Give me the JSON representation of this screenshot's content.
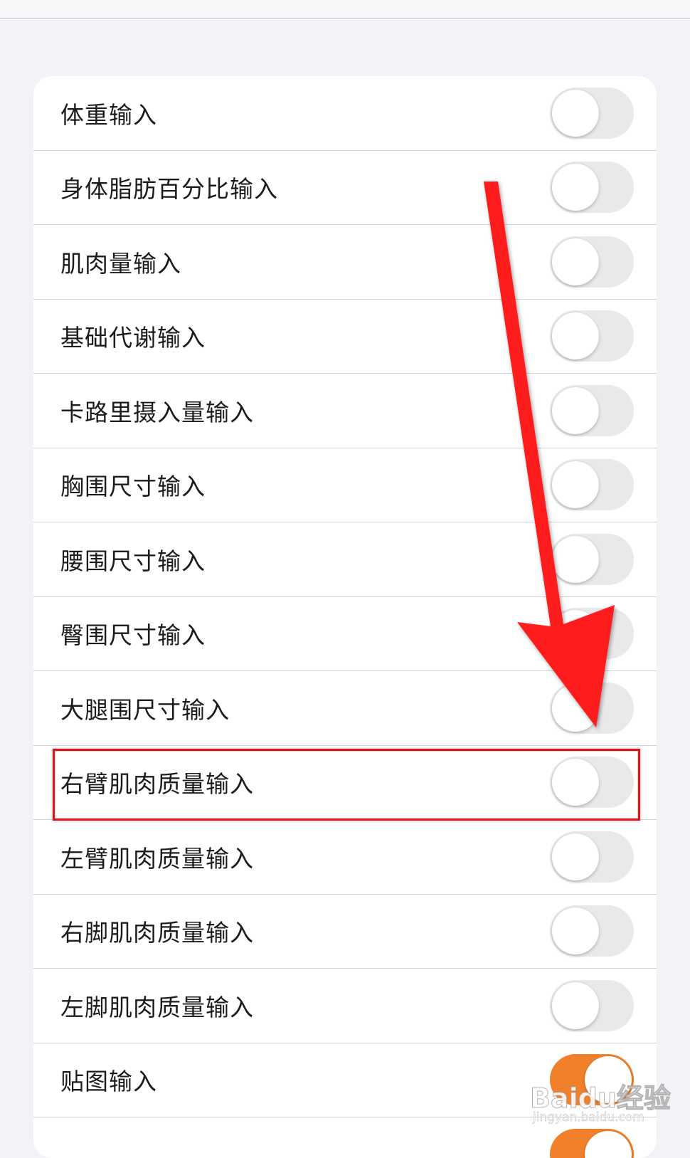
{
  "settings": {
    "items": [
      {
        "label": "体重输入",
        "on": false
      },
      {
        "label": "身体脂肪百分比输入",
        "on": false
      },
      {
        "label": "肌肉量输入",
        "on": false
      },
      {
        "label": "基础代谢输入",
        "on": false
      },
      {
        "label": "卡路里摄入量输入",
        "on": false
      },
      {
        "label": "胸围尺寸输入",
        "on": false
      },
      {
        "label": "腰围尺寸输入",
        "on": false
      },
      {
        "label": "臀围尺寸输入",
        "on": false
      },
      {
        "label": "大腿围尺寸输入",
        "on": false
      },
      {
        "label": "右臂肌肉质量输入",
        "on": false
      },
      {
        "label": "左臂肌肉质量输入",
        "on": false
      },
      {
        "label": "右脚肌肉质量输入",
        "on": false
      },
      {
        "label": "左脚肌肉质量输入",
        "on": false
      },
      {
        "label": "贴图输入",
        "on": true
      },
      {
        "label": "",
        "on": true
      }
    ]
  },
  "annotation": {
    "highlighted_item": "右臂肌肉质量输入",
    "highlight_color": "#e0141b",
    "arrow_color": "#ff1a1a",
    "toggle_on_color": "#f0802b",
    "toggle_off_color": "#e9e9eb"
  },
  "watermark": {
    "main": "Baidu经验",
    "sub": "jingyan.baidu.com"
  }
}
